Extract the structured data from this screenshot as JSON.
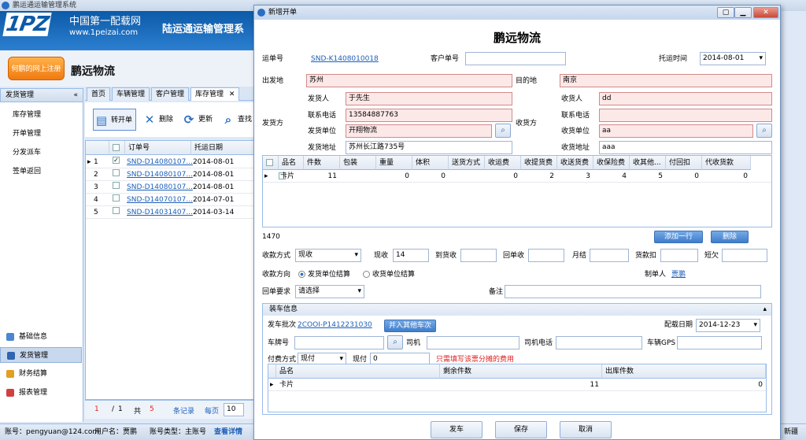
{
  "app": {
    "title": "鹏运通运输管理系统",
    "logo_text": "1PZ",
    "logo_cn": "中国第一配载网",
    "logo_url": "www.1peizai.com",
    "system_name": "陆运通运输管理系",
    "shop_button": "何鹏的网上注册",
    "company": "鹏远物流"
  },
  "left": {
    "header": "发货管理",
    "collapse": "«",
    "items": [
      "库存管理",
      "开单管理",
      "分发派车",
      "签单返回"
    ],
    "nav": [
      {
        "label": "基础信息",
        "icon": "info-icon"
      },
      {
        "label": "发货管理",
        "icon": "truck-icon"
      },
      {
        "label": "财务结算",
        "icon": "finance-icon"
      },
      {
        "label": "报表管理",
        "icon": "chart-icon"
      }
    ]
  },
  "tabs": [
    {
      "label": "首页"
    },
    {
      "label": "车辆管理"
    },
    {
      "label": "客户管理"
    },
    {
      "label": "库存管理",
      "close": "✕"
    }
  ],
  "toolbar": {
    "new": "转开单",
    "delete": "删除",
    "refresh": "更新",
    "search": "查找"
  },
  "grid": {
    "headers": [
      "订单号",
      "托运日期"
    ],
    "rows": [
      {
        "n": "1",
        "order": "SND-D14080107...",
        "date": "2014-08-01",
        "checked": true
      },
      {
        "n": "2",
        "order": "SND-D14080107...",
        "date": "2014-08-01",
        "checked": false
      },
      {
        "n": "3",
        "order": "SND-D14080107...",
        "date": "2014-08-01",
        "checked": false
      },
      {
        "n": "4",
        "order": "SND-D14070107...",
        "date": "2014-07-01",
        "checked": false
      },
      {
        "n": "5",
        "order": "SND-D14031407...",
        "date": "2014-03-14",
        "checked": false
      }
    ]
  },
  "pager": {
    "page": "1",
    "sep": "/",
    "total_pages": "1",
    "total_label": "共",
    "total": "5",
    "records": "条记录",
    "per_page_label": "每页",
    "per_page": "10"
  },
  "status": {
    "account": "账号：pengyuan@124.com",
    "user": "用户名：贾鹏",
    "type": "账号类型：主账号",
    "detail": "查看详情",
    "right": "新疆"
  },
  "dialog": {
    "title": "新增开单",
    "heading": "鹏远物流",
    "waybill_label": "运单号",
    "waybill": "SND-K1408010018",
    "customer_no_label": "客户单号",
    "customer_no": "",
    "ship_date_label": "托运时间",
    "ship_date": "2014-08-01",
    "origin_label": "出发地",
    "origin": "苏州",
    "dest_label": "目的地",
    "dest": "南京",
    "shipper_side": "发货方",
    "receiver_side": "收货方",
    "sender_label": "发货人",
    "sender": "于先生",
    "receiver_label": "收货人",
    "receiver": "dd",
    "sphone_label": "联系电话",
    "sphone": "13584887763",
    "rphone_label": "联系电话",
    "rphone": "",
    "sunit_label": "发货单位",
    "sunit": "开翔物流",
    "runit_label": "收货单位",
    "runit": "aa",
    "saddr_label": "发货地址",
    "saddr": "苏州长江路735号",
    "raddr_label": "收货地址",
    "raddr": "aaa",
    "goods_headers": [
      "品名",
      "件数",
      "包装",
      "重量",
      "体积",
      "送货方式",
      "收运费",
      "收提货费",
      "收送货费",
      "收保险费",
      "收其他...",
      "付回扣",
      "代收货款"
    ],
    "goods_row": [
      "卡片",
      "11",
      "",
      "0",
      "0",
      "",
      "0",
      "2",
      "3",
      "4",
      "5",
      "0",
      "0"
    ],
    "total": "1470",
    "add_row": "添加一行",
    "delete_row": "删除",
    "pay_method_label": "收款方式",
    "pay_method": "现收",
    "now_label": "现收",
    "now": "14",
    "arrive_label": "到货收",
    "arrive": "",
    "back_label": "回单收",
    "back": "",
    "month_label": "月结",
    "month": "",
    "deduct_label": "货款扣",
    "deduct": "",
    "owe_label": "短欠",
    "owe": "",
    "direction_label": "收款方向",
    "dir1": "发货单位结算",
    "dir2": "收货单位结算",
    "maker_label": "制单人",
    "maker": "贾鹏",
    "receipt_label": "回单要求",
    "receipt": "请选择",
    "remark_label": "备注",
    "remark": "",
    "load": {
      "header": "装车信息",
      "batch_label": "发车批次",
      "batch": "2COOI-P1412231030",
      "merge": "并入其他车次",
      "date_label": "配载日期",
      "date": "2014-12-23",
      "plate_label": "车牌号",
      "plate": "",
      "driver_label": "司机",
      "driver": "",
      "dphone_label": "司机电话",
      "dphone": "",
      "gps_label": "车辆GPS",
      "gps": "",
      "fee_label": "付费方式",
      "fee": "现付",
      "now_label": "现付",
      "now": "0",
      "hint": "只需填写该票分摊的费用",
      "headers": [
        "品名",
        "剩余件数",
        "出库件数"
      ],
      "row": [
        "卡片",
        "11",
        "0"
      ]
    },
    "buttons": {
      "ship": "发车",
      "save": "保存",
      "cancel": "取消"
    },
    "win": {
      "min": "▁",
      "max": "▢",
      "close": "✕"
    }
  }
}
